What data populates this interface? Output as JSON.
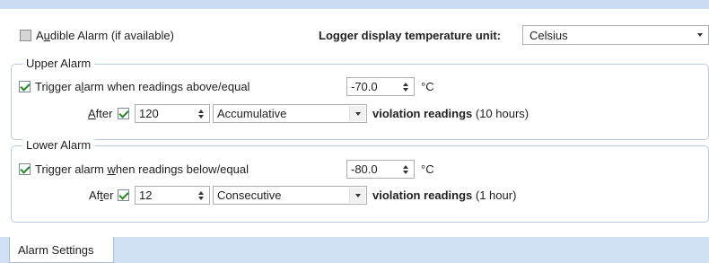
{
  "top": {
    "audible_label_pre": "A",
    "audible_label_u": "u",
    "audible_label_post": "dible Alarm (if available)",
    "audible_checked": false,
    "temp_unit_label": "Logger display temperature unit:",
    "temp_unit_value": "Celsius"
  },
  "upper": {
    "title": "Upper Alarm",
    "trigger_pre": "Trigger a",
    "trigger_u": "l",
    "trigger_post": "arm when readings above/equal",
    "trigger_checked": true,
    "threshold": "-70.0",
    "unit": "°C",
    "after_u": "A",
    "after_post": "fter",
    "after_checked": true,
    "count": "120",
    "mode": "Accumulative",
    "tail_bold": "violation readings",
    "tail_normal": "(10 hours)"
  },
  "lower": {
    "title": "Lower Alarm",
    "trigger_pre": "Trigger alarm ",
    "trigger_u": "w",
    "trigger_post": "hen readings below/equal",
    "trigger_checked": true,
    "threshold": "-80.0",
    "unit": "°C",
    "after_pre": "Af",
    "after_u": "t",
    "after_post": "er",
    "after_checked": true,
    "count": "12",
    "mode": "Consecutive",
    "tail_bold": "violation readings",
    "tail_normal": "(1 hour)"
  },
  "tabs": [
    {
      "label": "Alarm Settings",
      "active": true
    }
  ]
}
